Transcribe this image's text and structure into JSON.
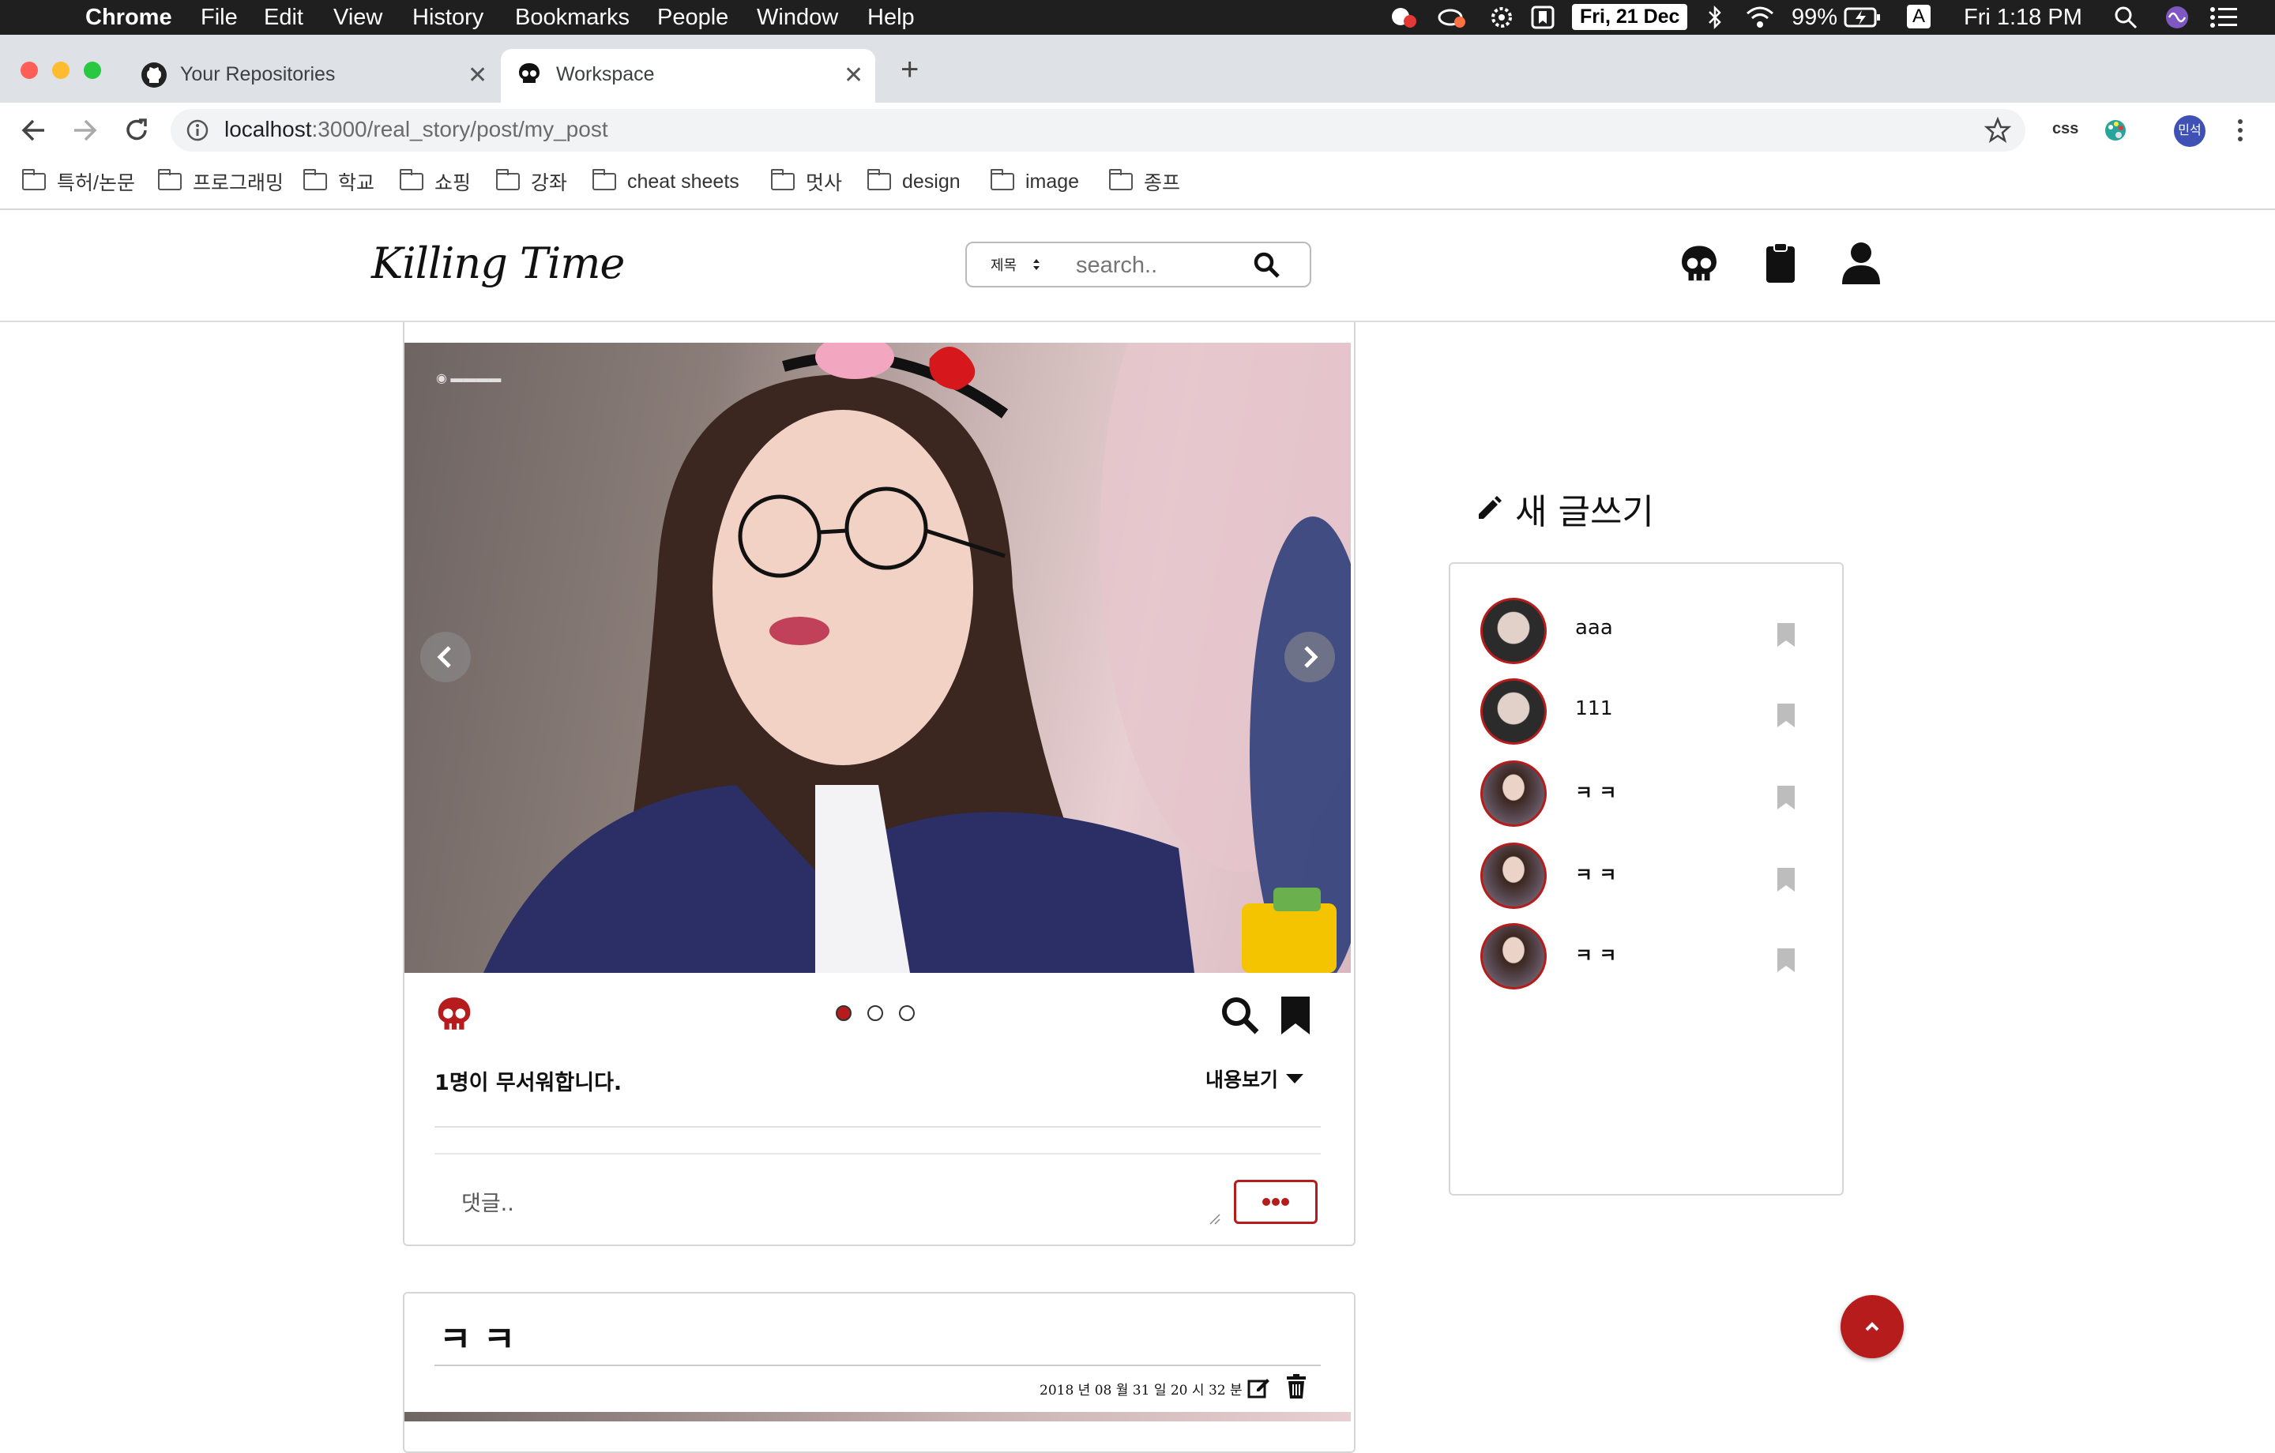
{
  "menubar": {
    "app": "Chrome",
    "items": [
      "File",
      "Edit",
      "View",
      "History",
      "Bookmarks",
      "People",
      "Window",
      "Help"
    ],
    "date_badge": "Fri, 21 Dec",
    "battery": "99%",
    "input_mode": "A",
    "clock": "Fri 1:18 PM"
  },
  "tabs": [
    {
      "title": "Your Repositories"
    },
    {
      "title": "Workspace"
    }
  ],
  "address": {
    "host": "localhost",
    "path": ":3000/real_story/post/my_post"
  },
  "extensions": {
    "css_label": "css",
    "profile_label": "민석"
  },
  "bookmarks": [
    "특허/논문",
    "프로그래밍",
    "학교",
    "쇼핑",
    "강좌",
    "cheat sheets",
    "멋사",
    "design",
    "image",
    "종프"
  ],
  "site": {
    "logo": "Killing Time",
    "search_select": "제목",
    "search_placeholder": "search.."
  },
  "post1": {
    "likes_text": "1명이 무서워합니다.",
    "view_content": "내용보기",
    "comment_placeholder": "댓글..",
    "carousel_total": 3,
    "carousel_active": 0
  },
  "post2": {
    "title": "ㅋ ㅋ",
    "date": "2018 년 08 월 31 일 20 시 32 분"
  },
  "sidebar": {
    "new_post": "새 글쓰기",
    "items": [
      {
        "title": "aaa"
      },
      {
        "title": "111"
      },
      {
        "title": "ㅋ ㅋ"
      },
      {
        "title": "ㅋ ㅋ"
      },
      {
        "title": "ㅋ ㅋ"
      }
    ]
  },
  "colors": {
    "accent": "#b71c1c",
    "menubar": "#1f1f1f",
    "tabstrip": "#dee1e6"
  }
}
